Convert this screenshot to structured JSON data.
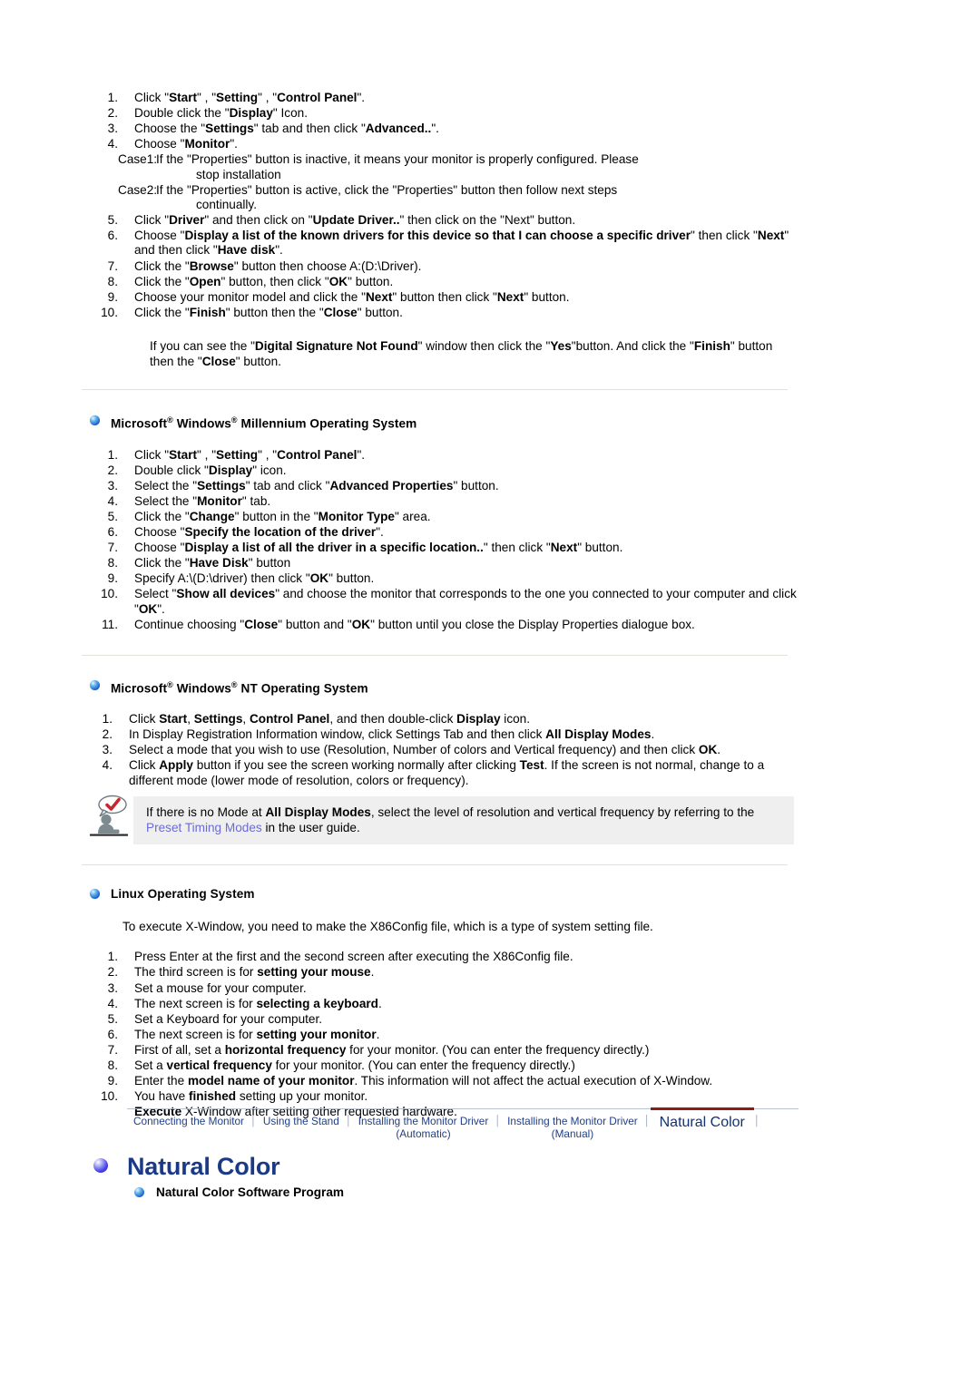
{
  "colors": {
    "link": "#6b6bd6",
    "nav_link": "#1f3f87",
    "nav_active_underline": "#8e1b16",
    "title": "#1a3a86",
    "note_bg": "#efefef",
    "rule": "#dfe3da"
  },
  "win2000": {
    "steps": [
      {
        "num": "1.",
        "parts": [
          {
            "t": "Click \"",
            "b": false
          },
          {
            "t": "Start",
            "b": true
          },
          {
            "t": "\" , \"",
            "b": false
          },
          {
            "t": "Setting",
            "b": true
          },
          {
            "t": "\" , \"",
            "b": false
          },
          {
            "t": "Control Panel",
            "b": true
          },
          {
            "t": "\".",
            "b": false
          }
        ]
      },
      {
        "num": "2.",
        "parts": [
          {
            "t": "Double click the \"",
            "b": false
          },
          {
            "t": "Display",
            "b": true
          },
          {
            "t": "\" Icon.",
            "b": false
          }
        ]
      },
      {
        "num": "3.",
        "parts": [
          {
            "t": "Choose the \"",
            "b": false
          },
          {
            "t": "Settings",
            "b": true
          },
          {
            "t": "\" tab and then click \"",
            "b": false
          },
          {
            "t": "Advanced..",
            "b": true
          },
          {
            "t": "\".",
            "b": false
          }
        ]
      },
      {
        "num": "4.",
        "parts": [
          {
            "t": "Choose \"",
            "b": false
          },
          {
            "t": "Monitor",
            "b": true
          },
          {
            "t": "\".",
            "b": false
          }
        ]
      }
    ],
    "case1_label": "Case1:",
    "case1_line1": "If the \"Properties\" button is inactive, it means your monitor is properly configured. Please",
    "case1_line2": "stop installation",
    "case2_label": "Case2:",
    "case2_line1": "If the \"Properties\" button is active, click the \"Properties\" button then follow next steps",
    "case2_line2": "continually.",
    "steps2": [
      {
        "num": "5.",
        "parts": [
          {
            "t": "Click \"",
            "b": false
          },
          {
            "t": "Driver",
            "b": true
          },
          {
            "t": "\" and then click on \"",
            "b": false
          },
          {
            "t": "Update Driver..",
            "b": true
          },
          {
            "t": "\" then click on the \"Next\" button.",
            "b": false
          }
        ]
      },
      {
        "num": "6.",
        "parts": [
          {
            "t": "Choose \"",
            "b": false
          },
          {
            "t": "Display a list of the known drivers for this device so that I can choose a specific driver",
            "b": true
          },
          {
            "t": "\" then click \"",
            "b": false
          },
          {
            "t": "Next",
            "b": true
          },
          {
            "t": "\" and then click \"",
            "b": false
          },
          {
            "t": "Have disk",
            "b": true
          },
          {
            "t": "\".",
            "b": false
          }
        ]
      },
      {
        "num": "7.",
        "parts": [
          {
            "t": "Click the \"",
            "b": false
          },
          {
            "t": "Browse",
            "b": true
          },
          {
            "t": "\" button then choose A:(D:\\Driver).",
            "b": false
          }
        ]
      },
      {
        "num": "8.",
        "parts": [
          {
            "t": "Click the \"",
            "b": false
          },
          {
            "t": "Open",
            "b": true
          },
          {
            "t": "\" button, then click \"",
            "b": false
          },
          {
            "t": "OK",
            "b": true
          },
          {
            "t": "\" button.",
            "b": false
          }
        ]
      },
      {
        "num": "9.",
        "parts": [
          {
            "t": "Choose your monitor model and click the \"",
            "b": false
          },
          {
            "t": "Next",
            "b": true
          },
          {
            "t": "\" button then click \"",
            "b": false
          },
          {
            "t": "Next",
            "b": true
          },
          {
            "t": "\" button.",
            "b": false
          }
        ]
      },
      {
        "num": "10.",
        "parts": [
          {
            "t": "Click the \"",
            "b": false
          },
          {
            "t": "Finish",
            "b": true
          },
          {
            "t": "\" button then the \"",
            "b": false
          },
          {
            "t": "Close",
            "b": true
          },
          {
            "t": "\" button.",
            "b": false
          }
        ]
      }
    ],
    "note": [
      {
        "t": "If you can see the \"",
        "b": false
      },
      {
        "t": "Digital Signature Not Found",
        "b": true
      },
      {
        "t": "\" window then click the \"",
        "b": false
      },
      {
        "t": "Yes",
        "b": true
      },
      {
        "t": "\"button. And click the \"",
        "b": false
      },
      {
        "t": "Finish",
        "b": true
      },
      {
        "t": "\" button then the \"",
        "b": false
      },
      {
        "t": "Close",
        "b": true
      },
      {
        "t": "\" button.",
        "b": false
      }
    ]
  },
  "millennium": {
    "heading_pre": "Microsoft",
    "heading_mid": " Windows",
    "heading_post": " Millennium Operating System",
    "reg": "®",
    "steps": [
      {
        "num": "1.",
        "parts": [
          {
            "t": "Click \"",
            "b": false
          },
          {
            "t": "Start",
            "b": true
          },
          {
            "t": "\" , \"",
            "b": false
          },
          {
            "t": "Setting",
            "b": true
          },
          {
            "t": "\" , \"",
            "b": false
          },
          {
            "t": "Control Panel",
            "b": true
          },
          {
            "t": "\".",
            "b": false
          }
        ]
      },
      {
        "num": "2.",
        "parts": [
          {
            "t": "Double click \"",
            "b": false
          },
          {
            "t": "Display",
            "b": true
          },
          {
            "t": "\" icon.",
            "b": false
          }
        ]
      },
      {
        "num": "3.",
        "parts": [
          {
            "t": "Select the \"",
            "b": false
          },
          {
            "t": "Settings",
            "b": true
          },
          {
            "t": "\" tab and click \"",
            "b": false
          },
          {
            "t": "Advanced Properties",
            "b": true
          },
          {
            "t": "\" button.",
            "b": false
          }
        ]
      },
      {
        "num": "4.",
        "parts": [
          {
            "t": "Select the \"",
            "b": false
          },
          {
            "t": "Monitor",
            "b": true
          },
          {
            "t": "\" tab.",
            "b": false
          }
        ]
      },
      {
        "num": "5.",
        "parts": [
          {
            "t": "Click the \"",
            "b": false
          },
          {
            "t": "Change",
            "b": true
          },
          {
            "t": "\" button in the \"",
            "b": false
          },
          {
            "t": "Monitor Type",
            "b": true
          },
          {
            "t": "\" area.",
            "b": false
          }
        ]
      },
      {
        "num": "6.",
        "parts": [
          {
            "t": "Choose \"",
            "b": false
          },
          {
            "t": "Specify the location of the driver",
            "b": true
          },
          {
            "t": "\".",
            "b": false
          }
        ]
      },
      {
        "num": "7.",
        "parts": [
          {
            "t": "Choose \"",
            "b": false
          },
          {
            "t": "Display a list of all the driver in a specific location..",
            "b": true
          },
          {
            "t": "\" then click \"",
            "b": false
          },
          {
            "t": "Next",
            "b": true
          },
          {
            "t": "\" button.",
            "b": false
          }
        ]
      },
      {
        "num": "8.",
        "parts": [
          {
            "t": "Click the \"",
            "b": false
          },
          {
            "t": "Have Disk",
            "b": true
          },
          {
            "t": "\" button",
            "b": false
          }
        ]
      },
      {
        "num": "9.",
        "parts": [
          {
            "t": "Specify A:\\(D:\\driver) then click \"",
            "b": false
          },
          {
            "t": "OK",
            "b": true
          },
          {
            "t": "\" button.",
            "b": false
          }
        ]
      },
      {
        "num": "10.",
        "parts": [
          {
            "t": "Select \"",
            "b": false
          },
          {
            "t": "Show all devices",
            "b": true
          },
          {
            "t": "\" and choose the monitor that corresponds to the one you connected to your computer and click \"",
            "b": false
          },
          {
            "t": "OK",
            "b": true
          },
          {
            "t": "\".",
            "b": false
          }
        ]
      },
      {
        "num": "11.",
        "parts": [
          {
            "t": "Continue choosing \"",
            "b": false
          },
          {
            "t": "Close",
            "b": true
          },
          {
            "t": "\" button and \"",
            "b": false
          },
          {
            "t": "OK",
            "b": true
          },
          {
            "t": "\" button until you close the Display Properties dialogue box.",
            "b": false
          }
        ]
      }
    ]
  },
  "winnt": {
    "heading_pre": "Microsoft",
    "heading_mid": " Windows",
    "heading_post": " NT Operating System",
    "reg": "®",
    "steps": [
      {
        "num": "1.",
        "parts": [
          {
            "t": "Click ",
            "b": false
          },
          {
            "t": "Start",
            "b": true
          },
          {
            "t": ", ",
            "b": false
          },
          {
            "t": "Settings",
            "b": true
          },
          {
            "t": ", ",
            "b": false
          },
          {
            "t": "Control Panel",
            "b": true
          },
          {
            "t": ", and then double-click ",
            "b": false
          },
          {
            "t": "Display",
            "b": true
          },
          {
            "t": " icon.",
            "b": false
          }
        ]
      },
      {
        "num": "2.",
        "parts": [
          {
            "t": "In Display Registration Information window, click Settings Tab and then click ",
            "b": false
          },
          {
            "t": "All Display Modes",
            "b": true
          },
          {
            "t": ".",
            "b": false
          }
        ]
      },
      {
        "num": "3.",
        "parts": [
          {
            "t": "Select a mode that you wish to use (Resolution, Number of colors and Vertical frequency) and then click ",
            "b": false
          },
          {
            "t": "OK",
            "b": true
          },
          {
            "t": ".",
            "b": false
          }
        ]
      },
      {
        "num": "4.",
        "parts": [
          {
            "t": "Click ",
            "b": false
          },
          {
            "t": "Apply",
            "b": true
          },
          {
            "t": " button if you see the screen working normally after clicking ",
            "b": false
          },
          {
            "t": "Test",
            "b": true
          },
          {
            "t": ". If the screen is not normal, change to a different mode (lower mode of resolution, colors or frequency).",
            "b": false
          }
        ]
      }
    ],
    "tipbox": {
      "icon_name": "person-speech-check-icon",
      "parts": [
        {
          "t": "If there is no Mode at ",
          "b": false,
          "link": false
        },
        {
          "t": "All Display Modes",
          "b": true,
          "link": false
        },
        {
          "t": ", select the level of resolution and vertical frequency by referring to the ",
          "b": false,
          "link": false
        },
        {
          "t": "Preset Timing Modes",
          "b": false,
          "link": true
        },
        {
          "t": " in the user guide.",
          "b": false,
          "link": false
        }
      ]
    }
  },
  "linux": {
    "heading": "Linux Operating System",
    "intro": "To execute X-Window, you need to make the X86Config file, which is a type of system setting file.",
    "steps": [
      {
        "num": "1.",
        "parts": [
          {
            "t": "Press Enter at the first and the second screen after executing the X86Config file.",
            "b": false
          }
        ]
      },
      {
        "num": "2.",
        "parts": [
          {
            "t": "The third screen is for ",
            "b": false
          },
          {
            "t": "setting your mouse",
            "b": true
          },
          {
            "t": ".",
            "b": false
          }
        ]
      },
      {
        "num": "3.",
        "parts": [
          {
            "t": "Set a mouse for your computer.",
            "b": false
          }
        ]
      },
      {
        "num": "4.",
        "parts": [
          {
            "t": "The next screen is for ",
            "b": false
          },
          {
            "t": "selecting a keyboard",
            "b": true
          },
          {
            "t": ".",
            "b": false
          }
        ]
      },
      {
        "num": "5.",
        "parts": [
          {
            "t": "Set a Keyboard for your computer.",
            "b": false
          }
        ]
      },
      {
        "num": "6.",
        "parts": [
          {
            "t": "The next screen is for ",
            "b": false
          },
          {
            "t": "setting your monitor",
            "b": true
          },
          {
            "t": ".",
            "b": false
          }
        ]
      },
      {
        "num": "7.",
        "parts": [
          {
            "t": "First of all, set a ",
            "b": false
          },
          {
            "t": "horizontal frequency",
            "b": true
          },
          {
            "t": " for your monitor. (You can enter the frequency directly.)",
            "b": false
          }
        ]
      },
      {
        "num": "8.",
        "parts": [
          {
            "t": "Set a ",
            "b": false
          },
          {
            "t": "vertical frequency",
            "b": true
          },
          {
            "t": " for your monitor. (You can enter the frequency directly.)",
            "b": false
          }
        ]
      },
      {
        "num": "9.",
        "parts": [
          {
            "t": "Enter the ",
            "b": false
          },
          {
            "t": "model name of your monitor",
            "b": true
          },
          {
            "t": ". This information will not affect the actual execution of X-Window.",
            "b": false
          }
        ]
      },
      {
        "num": "10.",
        "parts": [
          {
            "t": "You have ",
            "b": false
          },
          {
            "t": "finished",
            "b": true
          },
          {
            "t": " setting up your monitor.",
            "b": false
          }
        ]
      }
    ],
    "final_line": [
      {
        "t": "Execute",
        "b": true
      },
      {
        "t": " X-Window after setting other requested hardware.",
        "b": false
      }
    ]
  },
  "nav": {
    "items": [
      {
        "label": "Connecting the Monitor",
        "active": false
      },
      {
        "label": "Using the Stand",
        "active": false
      },
      {
        "label": "Installing the Monitor Driver\n(Automatic)",
        "active": false
      },
      {
        "label": "Installing the Monitor Driver\n(Manual)",
        "active": false
      },
      {
        "label": "Natural Color",
        "active": true
      }
    ],
    "separator": "│"
  },
  "title_block": {
    "title": "Natural Color",
    "subheading": "Natural Color Software Program"
  }
}
